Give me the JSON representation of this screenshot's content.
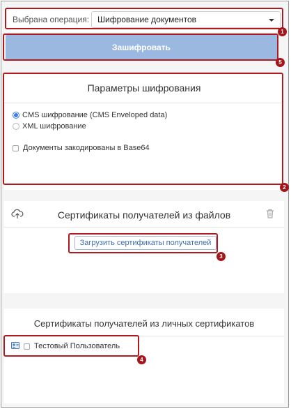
{
  "operation": {
    "label": "Выбрана операция:",
    "selected": "Шифрование документов"
  },
  "encrypt_button": {
    "label": "Зашифровать"
  },
  "params": {
    "title": "Параметры шифрования",
    "options": [
      "CMS шифрование (CMS Enveloped data)",
      "XML шифрование"
    ],
    "selected_option": 0,
    "base64_label": "Документы закодированы в Base64"
  },
  "file_certs": {
    "title": "Сертификаты получателей из файлов",
    "upload_label": "Загрузить сертификаты получателей"
  },
  "personal_certs": {
    "title": "Сертификаты получателей из личных сертификатов",
    "items": [
      {
        "name": "Тестовый Пользователь"
      }
    ]
  },
  "badges": [
    "1",
    "2",
    "3",
    "4",
    "5"
  ],
  "colors": {
    "accent": "#3d7de0",
    "button": "#9ab8e0",
    "highlight": "#b0191e"
  }
}
